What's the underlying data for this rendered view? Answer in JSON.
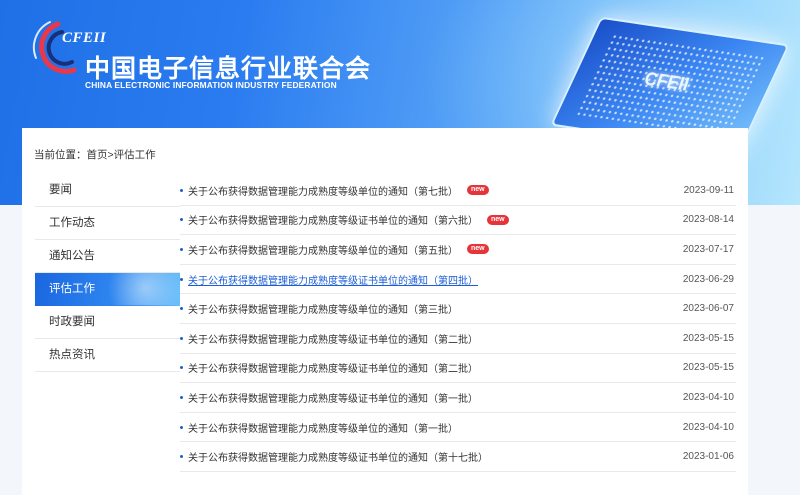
{
  "header": {
    "logo_text": "CFEII",
    "org_name_cn": "中国电子信息行业联合会",
    "org_name_en": "CHINA ELECTRONIC INFORMATION INDUSTRY FEDERATION",
    "chip_text": "CFEII"
  },
  "breadcrumb": {
    "prefix": "当前位置：",
    "home": "首页",
    "separator": ">",
    "current": "评估工作"
  },
  "sidebar": {
    "items": [
      {
        "label": "要闻"
      },
      {
        "label": "工作动态"
      },
      {
        "label": "通知公告"
      },
      {
        "label": "评估工作"
      },
      {
        "label": "时政要闻"
      },
      {
        "label": "热点资讯"
      }
    ],
    "active_index": 3
  },
  "news_list": {
    "new_badge": "new",
    "rows": [
      {
        "title": "关于公布获得数据管理能力成熟度等级单位的通知（第七批）",
        "date": "2023-09-11",
        "is_new": true
      },
      {
        "title": "关于公布获得数据管理能力成熟度等级证书单位的通知（第六批）",
        "date": "2023-08-14",
        "is_new": true
      },
      {
        "title": "关于公布获得数据管理能力成熟度等级单位的通知（第五批）",
        "date": "2023-07-17",
        "is_new": true
      },
      {
        "title": "关于公布获得数据管理能力成熟度等级证书单位的通知（第四批）",
        "date": "2023-06-29",
        "is_new": false,
        "hovered": true
      },
      {
        "title": "关于公布获得数据管理能力成熟度等级单位的通知（第三批）",
        "date": "2023-06-07",
        "is_new": false
      },
      {
        "title": "关于公布获得数据管理能力成熟度等级证书单位的通知（第二批）",
        "date": "2023-05-15",
        "is_new": false
      },
      {
        "title": "关于公布获得数据管理能力成熟度等级证书单位的通知（第二批）",
        "date": "2023-05-15",
        "is_new": false
      },
      {
        "title": "关于公布获得数据管理能力成熟度等级证书单位的通知（第一批）",
        "date": "2023-04-10",
        "is_new": false
      },
      {
        "title": "关于公布获得数据管理能力成熟度等级单位的通知（第一批）",
        "date": "2023-04-10",
        "is_new": false
      },
      {
        "title": "关于公布获得数据管理能力成熟度等级证书单位的通知（第十七批）",
        "date": "2023-01-06",
        "is_new": false
      }
    ]
  },
  "colors": {
    "brand_blue": "#1f6fe6",
    "accent_red": "#e5343a",
    "link_blue": "#1c5ed6"
  }
}
